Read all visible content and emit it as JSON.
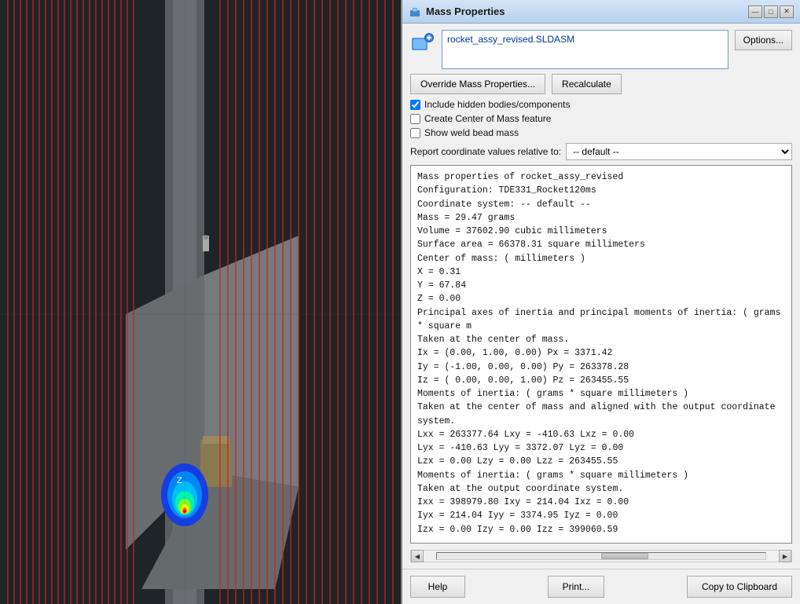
{
  "dialog": {
    "title": "Mass Properties",
    "filename": "rocket_assy_revised.SLDASM",
    "options_label": "Options...",
    "override_label": "Override Mass Properties...",
    "recalculate_label": "Recalculate",
    "checkboxes": [
      {
        "id": "chk1",
        "label": "Include hidden bodies/components",
        "checked": true
      },
      {
        "id": "chk2",
        "label": "Create Center of Mass feature",
        "checked": false
      },
      {
        "id": "chk3",
        "label": "Show weld bead mass",
        "checked": false
      }
    ],
    "coord_label": "Report coordinate values relative to:",
    "coord_value": "-- default --",
    "results": {
      "line1": "Mass properties of rocket_assy_revised",
      "line2": "     Configuration: TDE331_Rocket120ms",
      "line3": "     Coordinate system: -- default --",
      "line4": "",
      "line5": "Mass = 29.47 grams",
      "line6": "",
      "line7": "Volume = 37602.90 cubic millimeters",
      "line8": "",
      "line9": "Surface area = 66378.31  square millimeters",
      "line10": "",
      "line11": "Center of mass: ( millimeters )",
      "line12": "     X = 0.31",
      "line13": "     Y = 67.84",
      "line14": "     Z = 0.00",
      "line15": "",
      "line16": "Principal axes of inertia and principal moments of inertia: ( grams * square m",
      "line17": "Taken at the center of mass.",
      "line18": "     Ix = (0.00,  1.00,  0.00)       Px = 3371.42",
      "line19": "     Iy = (-1.00,  0.00,  0.00)      Py = 263378.28",
      "line20": "     Iz = ( 0.00,  0.00,  1.00)      Pz = 263455.55",
      "line21": "",
      "line22": "Moments of inertia: ( grams * square millimeters )",
      "line23": "Taken at the center of mass and aligned with the output coordinate system.",
      "line24": "     Lxx = 263377.64          Lxy = -410.63              Lxz = 0.00",
      "line25": "     Lyx = -410.63            Lyy = 3372.07              Lyz = 0.00",
      "line26": "     Lzx = 0.00               Lzy = 0.00                 Lzz = 263455.55",
      "line27": "",
      "line28": "Moments of inertia: ( grams * square millimeters )",
      "line29": "Taken at the output coordinate system.",
      "line30": "     Ixx = 398979.80          Ixy = 214.04               Ixz = 0.00",
      "line31": "     Iyx = 214.04             Iyy = 3374.95              Iyz = 0.00",
      "line32": "     Izx = 0.00               Izy = 0.00                 Izz = 399060.59"
    },
    "buttons": {
      "help": "Help",
      "print": "Print...",
      "copy": "Copy to Clipboard"
    },
    "title_controls": {
      "minimize": "—",
      "maximize": "□",
      "close": "✕"
    }
  }
}
